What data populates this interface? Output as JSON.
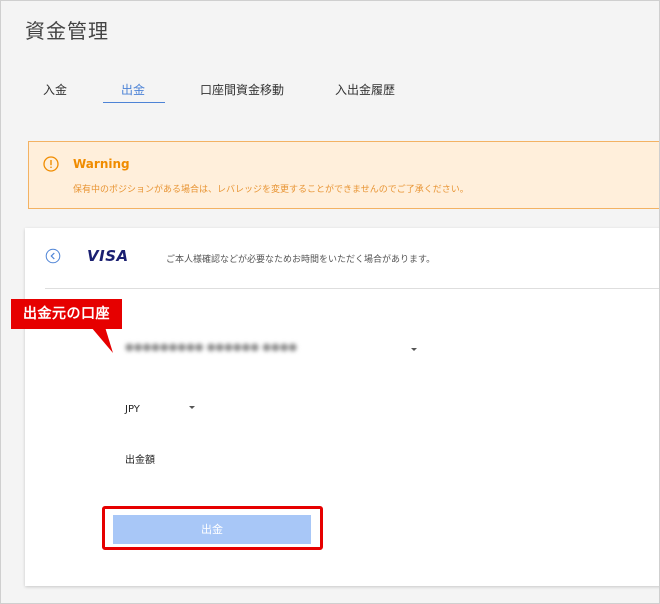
{
  "page": {
    "title": "資金管理"
  },
  "tabs": [
    {
      "label": "入金",
      "active": false
    },
    {
      "label": "出金",
      "active": true
    },
    {
      "label": "口座間資金移動",
      "active": false
    },
    {
      "label": "入出金履歴",
      "active": false
    }
  ],
  "warning": {
    "title": "Warning",
    "message": "保有中のポジションがある場合は、レバレッジを変更することができませんのでご了承ください。",
    "icon": "exclamation-circle-icon"
  },
  "card": {
    "brand": "VISA",
    "note": "ご本人様確認などが必要なためお時間をいただく場合があります。",
    "account_select": {
      "value": "●●●●●●●●● ●●●●●● ●●●●"
    },
    "currency_select": {
      "value": "JPY"
    },
    "amount_label": "出金額",
    "submit_label": "出金"
  },
  "annotation": {
    "callout_text": "出金元の口座"
  },
  "colors": {
    "accent": "#4d83d6",
    "warning_bg": "#ffefdb",
    "warning_border": "#f3b263",
    "warning_text": "#f08c00",
    "button_bg": "#a8c7f7",
    "annotation_red": "#e60000"
  }
}
